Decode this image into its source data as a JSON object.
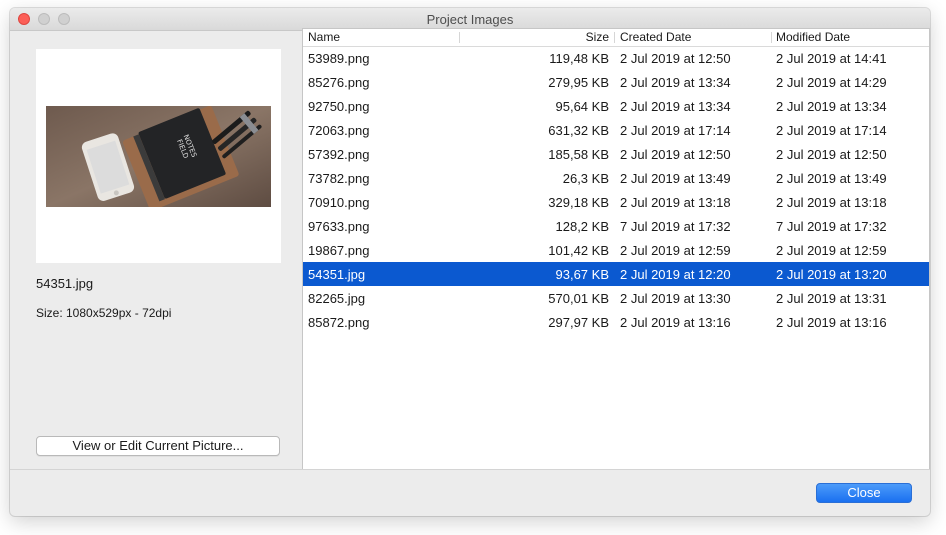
{
  "window": {
    "title": "Project Images"
  },
  "preview": {
    "file_name": "54351.jpg",
    "size_info": "Size: 1080x529px  - 72dpi",
    "view_button_label": "View or Edit Current Picture...",
    "image_subject": "phone, field-notes notebook and pens on wooden desk"
  },
  "table": {
    "columns": {
      "name": "Name",
      "size": "Size",
      "created": "Created Date",
      "modified": "Modified Date"
    },
    "rows": [
      {
        "name": "53989.png",
        "size": "119,48 KB",
        "created": "2 Jul 2019 at 12:50",
        "modified": "2 Jul 2019 at 14:41"
      },
      {
        "name": "85276.png",
        "size": "279,95 KB",
        "created": "2 Jul 2019 at 13:34",
        "modified": "2 Jul 2019 at 14:29"
      },
      {
        "name": "92750.png",
        "size": "95,64 KB",
        "created": "2 Jul 2019 at 13:34",
        "modified": "2 Jul 2019 at 13:34"
      },
      {
        "name": "72063.png",
        "size": "631,32 KB",
        "created": "2 Jul 2019 at 17:14",
        "modified": "2 Jul 2019 at 17:14"
      },
      {
        "name": "57392.png",
        "size": "185,58 KB",
        "created": "2 Jul 2019 at 12:50",
        "modified": "2 Jul 2019 at 12:50"
      },
      {
        "name": "73782.png",
        "size": "26,3 KB",
        "created": "2 Jul 2019 at 13:49",
        "modified": "2 Jul 2019 at 13:49"
      },
      {
        "name": "70910.png",
        "size": "329,18 KB",
        "created": "2 Jul 2019 at 13:18",
        "modified": "2 Jul 2019 at 13:18"
      },
      {
        "name": "97633.png",
        "size": "128,2 KB",
        "created": "7 Jul 2019 at 17:32",
        "modified": "7 Jul 2019 at 17:32"
      },
      {
        "name": "19867.png",
        "size": "101,42 KB",
        "created": "2 Jul 2019 at 12:59",
        "modified": "2 Jul 2019 at 12:59"
      },
      {
        "name": "54351.jpg",
        "size": "93,67 KB",
        "created": "2 Jul 2019 at 12:20",
        "modified": "2 Jul 2019 at 13:20"
      },
      {
        "name": "82265.jpg",
        "size": "570,01 KB",
        "created": "2 Jul 2019 at 13:30",
        "modified": "2 Jul 2019 at 13:31"
      },
      {
        "name": "85872.png",
        "size": "297,97 KB",
        "created": "2 Jul 2019 at 13:16",
        "modified": "2 Jul 2019 at 13:16"
      }
    ],
    "selected_index": 9
  },
  "footer": {
    "close_label": "Close"
  },
  "colors": {
    "selection": "#0b59d0",
    "close_button": "#1a70f0",
    "window_bg": "#ececec"
  }
}
